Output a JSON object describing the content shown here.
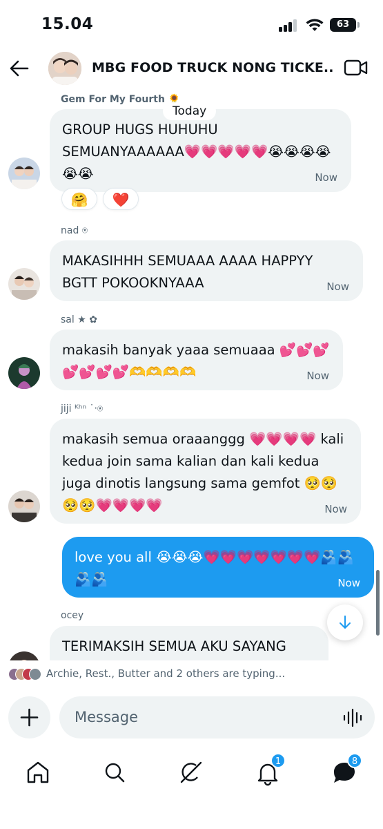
{
  "status_bar": {
    "time": "15.04",
    "battery": "63"
  },
  "header": {
    "title": "MBG FOOD TRUCK NONG TICKE..."
  },
  "today_label": "Today",
  "messages": [
    {
      "sender": "Gem For My Fourth 🌻",
      "text": "GROUP HUGS HUHUHU SEMUANYAAAAAA💗💗💗💗💗😭😭😭😭😭😭",
      "time": "Now",
      "reactions": [
        "🤗",
        "❤️"
      ]
    },
    {
      "sender": "nad ⍟",
      "text": "MAKASIHHH SEMUAAA AAAA HAPPYY BGTT POKOOKNYAAA",
      "time": "Now"
    },
    {
      "sender": "sal ★ ✿",
      "text": "makasih banyak yaaa semuaaa 💕💕💕💕💕💕💕🫶🫶🫶🫶",
      "time": "Now"
    },
    {
      "sender": "jiji ᴷʰⁿ ˙‧⍟",
      "text": "makasih semua oraaanggg 💗💗💗💗 kali kedua join sama kalian dan kali kedua juga dinotis langsung sama gemfot 🥺🥺🥺🥺💗💗💗💗",
      "time": "Now"
    },
    {
      "sender": "",
      "text": "love you all 😭😭😭💗💗💗💗💗💗💗🫂🫂🫂🫂",
      "time": "Now",
      "mine": true
    },
    {
      "sender": "ocey",
      "text": "TERIMAKSIH SEMUA AKU SAYANG",
      "time": ""
    }
  ],
  "typing": {
    "text": "Archie, Rest., Butter and 2 others are typing..."
  },
  "composer": {
    "placeholder": "Message"
  },
  "nav": {
    "items": [
      "home-icon",
      "search-icon",
      "grok-icon",
      "notifications-icon",
      "messages-icon"
    ],
    "notifications_badge": "1",
    "messages_badge": "8"
  },
  "colors": {
    "accent": "#1d9bf0",
    "bubble_gray": "#eff3f4",
    "text_primary": "#0f1419",
    "text_secondary": "#536471"
  }
}
